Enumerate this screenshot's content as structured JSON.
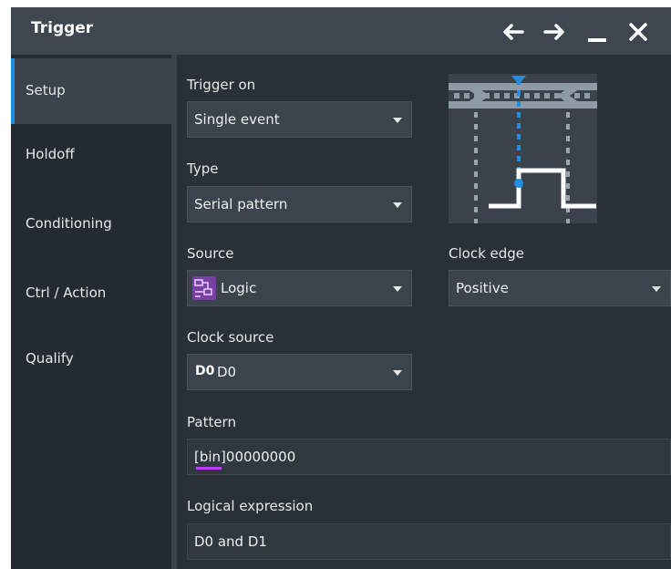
{
  "window": {
    "title": "Trigger",
    "controls": [
      "arrow-left-icon",
      "arrow-right-icon",
      "minimize-icon",
      "close-icon"
    ]
  },
  "sidebar": {
    "items": [
      {
        "label": "Setup",
        "active": true
      },
      {
        "label": "Holdoff",
        "active": false
      },
      {
        "label": "Conditioning",
        "active": false
      },
      {
        "label": "Ctrl / Action",
        "active": false
      },
      {
        "label": "Qualify",
        "active": false
      }
    ]
  },
  "form": {
    "trigger_on": {
      "label": "Trigger on",
      "value": "Single event"
    },
    "type": {
      "label": "Type",
      "value": "Serial pattern"
    },
    "source": {
      "label": "Source",
      "value": "Logic",
      "icon": "logic-icon"
    },
    "clock_edge": {
      "label": "Clock edge",
      "value": "Positive"
    },
    "clock_source": {
      "label": "Clock source",
      "badge": "D0",
      "value": "D0"
    },
    "pattern": {
      "label": "Pattern",
      "prefix": "[bin]",
      "value": "00000000"
    },
    "logical_expression": {
      "label": "Logical expression",
      "value": "D0 and D1"
    }
  },
  "colors": {
    "accent": "#1e8fe0",
    "panel": "#293038",
    "sidebar": "#232a31",
    "titlebar": "#3e4650",
    "logic_icon": "#7a3fa3",
    "bin_marker": "#c040ff"
  }
}
